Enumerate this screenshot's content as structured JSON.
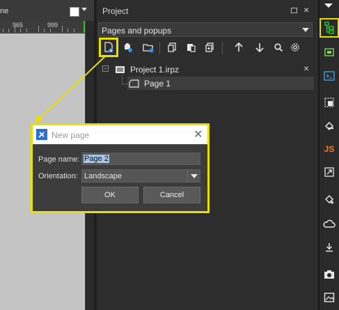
{
  "editor": {
    "font_label": "ne",
    "ruler_labels": [
      "965",
      "999"
    ],
    "swatch_color": "#ffffff"
  },
  "panel": {
    "title": "Project",
    "combo_value": "Pages and popups",
    "toolbar_icons": [
      "new-page-icon",
      "new-popup-icon",
      "new-folder-icon",
      "copy-icon",
      "paste-icon",
      "duplicate-icon",
      "move-up-icon",
      "move-down-icon",
      "search-icon",
      "settings-icon"
    ],
    "tree": {
      "project_name": "Project 1.irpz",
      "collapse_symbol": "−",
      "pages": [
        {
          "label": "Page 1"
        }
      ]
    }
  },
  "right_toolbar": {
    "icons": [
      "project-tree-icon",
      "components-icon",
      "console-icon",
      "image-resize-icon",
      "fill-icon",
      "js-icon",
      "scale-icon",
      "fill-plus-icon",
      "cloud-icon",
      "download-icon",
      "camera-icon",
      "picture-icon"
    ],
    "js_label": "JS"
  },
  "dialog": {
    "title": "New page",
    "page_name_label": "Page name:",
    "page_name_value": "Page 2",
    "orientation_label": "Orientation:",
    "orientation_value": "Landscape",
    "ok_label": "OK",
    "cancel_label": "Cancel",
    "close_symbol": "✕"
  },
  "colors": {
    "highlight": "#e8e000",
    "accent": "#22cc22",
    "dialog_icon": "#2b6fd6"
  }
}
